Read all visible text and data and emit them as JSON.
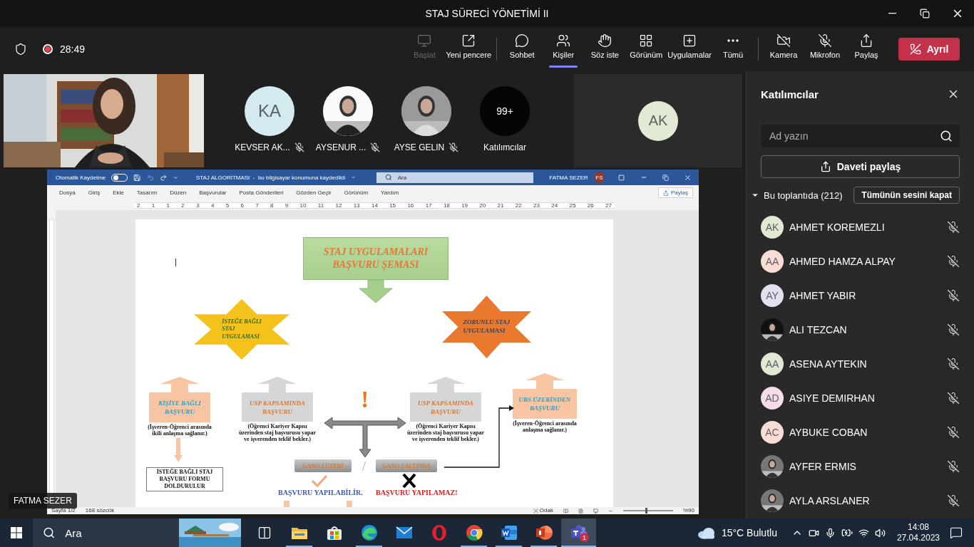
{
  "window": {
    "title": "STAJ SÜRECİ YÖNETİMİ II"
  },
  "meeting_bar": {
    "timer": "28:49",
    "recording": true,
    "tool_groups": [
      [
        {
          "kind": "start",
          "label": "Başlat",
          "disabled": true,
          "selected": false
        },
        {
          "kind": "popout",
          "label": "Yeni pencere",
          "disabled": false,
          "selected": false
        }
      ],
      [
        {
          "kind": "chat",
          "label": "Sohbet",
          "disabled": false,
          "selected": false
        },
        {
          "kind": "people",
          "label": "Kişiler",
          "disabled": false,
          "selected": true
        },
        {
          "kind": "hand",
          "label": "Söz iste",
          "disabled": false,
          "selected": false
        },
        {
          "kind": "view",
          "label": "Görünüm",
          "disabled": false,
          "selected": false
        },
        {
          "kind": "apps",
          "label": "Uygulamalar",
          "disabled": false,
          "selected": false
        },
        {
          "kind": "more",
          "label": "Tümü",
          "disabled": false,
          "selected": false
        }
      ],
      [
        {
          "kind": "camera",
          "label": "Kamera",
          "disabled": false,
          "selected": false
        },
        {
          "kind": "mic",
          "label": "Mikrofon",
          "disabled": false,
          "selected": false
        },
        {
          "kind": "share",
          "label": "Paylaş",
          "disabled": false,
          "selected": false
        }
      ]
    ],
    "leave": "Ayrıl"
  },
  "stage": {
    "tiles": [
      {
        "kind": "initials",
        "initials": "KA",
        "color": "#d4eaee",
        "name": "KEVSER AK...",
        "muted": true
      },
      {
        "name": "AYSENUR ...",
        "muted": true
      },
      {
        "name": "AYSE GELIN",
        "muted": true
      },
      {
        "kind": "overflow",
        "count": "99+",
        "name": "Katılımcılar",
        "muted": false
      }
    ],
    "spotlight": {
      "initials": "AK",
      "color": "#e1ead4"
    },
    "presenter": "FATMA SEZER"
  },
  "word": {
    "autosave": {
      "label": "Otomatik Kaydetme",
      "on": false
    },
    "title": "STAJ ALGORİTMASI  -  bu bilgisayar konumuna kaydedildi",
    "search": {
      "placeholder": "Ara"
    },
    "user": {
      "name": "FATMA SEZER",
      "initials": "FS"
    },
    "menu": [
      "Dosya",
      "Giriş",
      "Ekle",
      "Tasarım",
      "Düzen",
      "Başvurular",
      "Posta Gönderileri",
      "Gözden Geçir",
      "Görünüm",
      "Yardım"
    ],
    "share": "Paylaş",
    "ruler_marks": [
      "2",
      "1",
      "1",
      "2",
      "3",
      "4",
      "5",
      "6",
      "7",
      "8",
      "9",
      "10",
      "11",
      "12",
      "13",
      "14",
      "15",
      "16",
      "17",
      "18",
      "19",
      "20",
      "21",
      "22",
      "23",
      "24",
      "25",
      "26",
      "27"
    ],
    "status": {
      "page": "Sayfa 1/2",
      "words": "168 sözcük",
      "focus": "Odak",
      "zoom": {
        "reading": "%90",
        "level": 0.45
      }
    },
    "diagram": {
      "title": [
        "STAJ UYGULAMALARI",
        "BAŞVURU ŞEMASI"
      ],
      "stars": [
        {
          "lines": [
            "İSTEĞE BAĞLI",
            "STAJ",
            "UYGULAMASI"
          ],
          "color": "#f4c21a"
        },
        {
          "lines": [
            "ZORUNLU STAJ",
            "UYGULAMASI"
          ],
          "color": "#e8792f"
        }
      ],
      "routes": [
        {
          "kind": "peach",
          "lines": [
            "KİŞİYE BAĞLI",
            "BAŞVURU"
          ],
          "note": [
            "(İşveren-Öğrenci arasında",
            "ikili anlaşma sağlanır.)"
          ]
        },
        {
          "kind": "grey",
          "lines": [
            "USP KAPSAMINDA",
            "BAŞVURU"
          ],
          "note": [
            "(Öğrenci Kariyer Kapısı",
            "üzerinden staj başvurusu yapar",
            "ve işverenden teklif bekler.)"
          ]
        },
        {
          "kind": "grey",
          "lines": [
            "USP KAPSAMINDA",
            "BAŞVURU"
          ],
          "note": [
            "(Öğrenci Kariyer Kapısı",
            "üzerinden staj başvurusu yapar",
            "ve işverenden teklif bekler.)"
          ]
        },
        {
          "kind": "peach",
          "lines": [
            "UBS ÜZERİNDEN",
            "BAŞVURU"
          ],
          "note": [
            "(İşveren-Öğrenci arasında",
            "anlaşma sağlanır.)"
          ]
        }
      ],
      "form": [
        "İSTEĞE BAĞLI STAJ",
        "BAŞVURU FORMU",
        "DOLDURULUR"
      ],
      "alert": "!",
      "gano": [
        "GANO 2 ÜZERİ",
        "GANO 2 ALTINDA"
      ],
      "separator": "/",
      "outcomes": [
        {
          "text": "BAŞVURU YAPILABİLİR.",
          "allowed": true
        },
        {
          "text": "BAŞVURU YAPILAMAZ!",
          "allowed": false
        }
      ]
    }
  },
  "participants": {
    "title": "Katılımcılar",
    "search": {
      "placeholder": "Ad yazın"
    },
    "invite": "Daveti paylaş",
    "section": {
      "label": "Bu toplantıda (212)",
      "expanded": true,
      "mute_all": "Tümünün sesini kapat"
    },
    "people": [
      {
        "kind": "initials",
        "initials": "AK",
        "color": "#dfe9d4",
        "name": "AHMET KOREMEZLI",
        "muted": true
      },
      {
        "kind": "initials",
        "initials": "AA",
        "color": "#f8dcd6",
        "name": "AHMED HAMZA ALPAY",
        "muted": true
      },
      {
        "kind": "initials",
        "initials": "AY",
        "color": "#e4e0f2",
        "name": "AHMET YABIR",
        "muted": true
      },
      {
        "name": "ALI TEZCAN",
        "muted": true
      },
      {
        "kind": "initials",
        "initials": "AA",
        "color": "#dfe9d4",
        "name": "ASENA AYTEKIN",
        "muted": true
      },
      {
        "kind": "initials",
        "initials": "AD",
        "color": "#f4dcea",
        "name": "ASIYE DEMIRHAN",
        "muted": true
      },
      {
        "kind": "initials",
        "initials": "AC",
        "color": "#f8dcd6",
        "name": "AYBUKE COBAN",
        "muted": true
      },
      {
        "name": "AYFER ERMIS",
        "muted": true
      },
      {
        "name": "AYLA ARSLANER",
        "muted": true
      }
    ]
  },
  "taskbar": {
    "search": {
      "placeholder": "Ara"
    },
    "apps": [
      {
        "kind": "taskview",
        "running": false,
        "active": false
      },
      {
        "kind": "explorer",
        "running": true,
        "active": false
      },
      {
        "kind": "store",
        "running": false,
        "active": false
      },
      {
        "kind": "edge",
        "running": true,
        "active": false
      },
      {
        "kind": "mail",
        "running": false,
        "active": false
      },
      {
        "kind": "opera",
        "running": false,
        "active": false
      },
      {
        "kind": "chrome",
        "running": true,
        "active": false
      },
      {
        "kind": "word",
        "running": true,
        "active": false
      },
      {
        "kind": "powerpoint",
        "running": true,
        "active": false
      },
      {
        "kind": "teams",
        "running": true,
        "active": true,
        "badge": "1"
      }
    ],
    "weather": "15°C Bulutlu",
    "time": "14:08",
    "date": "27.04.2023"
  }
}
